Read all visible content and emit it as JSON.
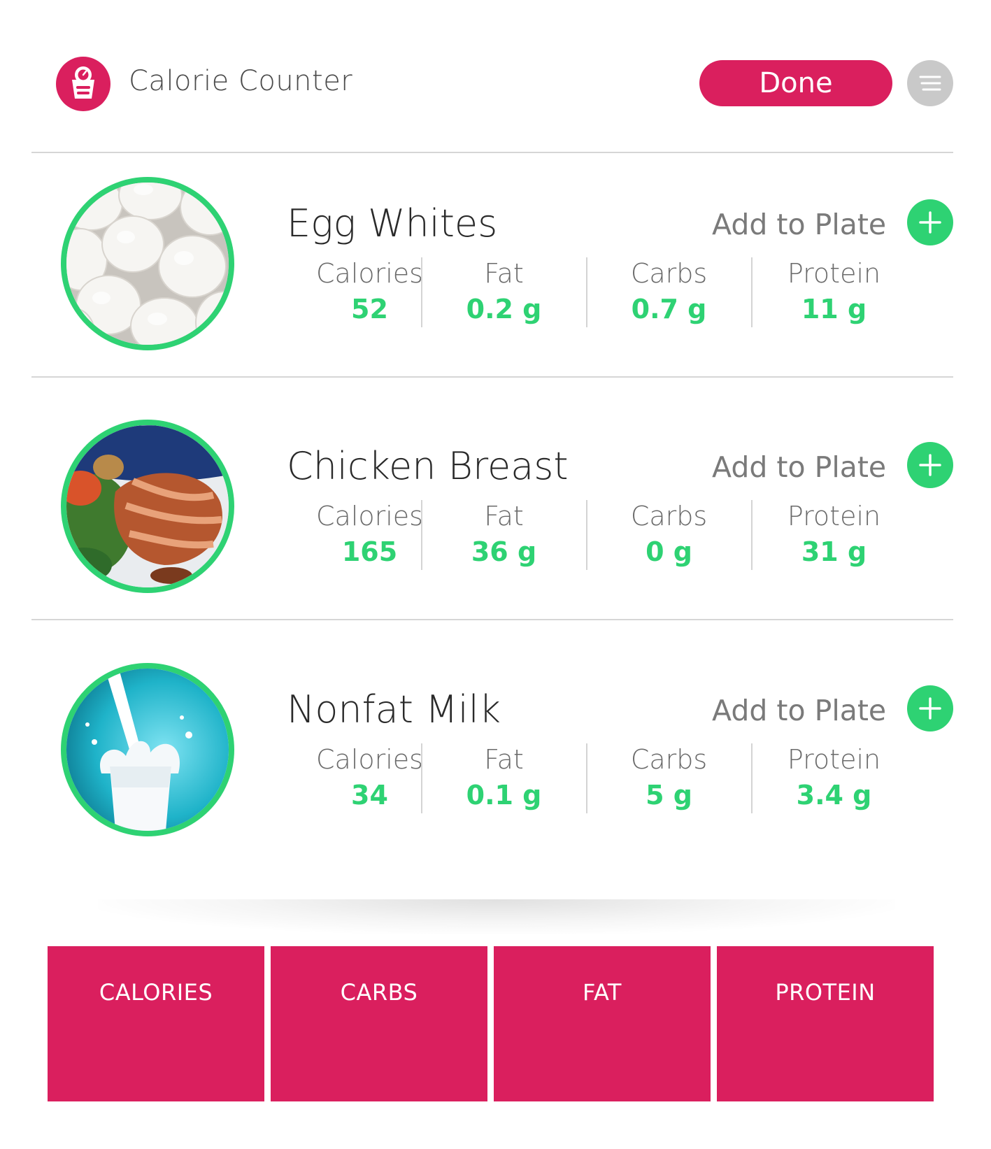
{
  "header": {
    "app_title": "Calorie Counter",
    "done_label": "Done",
    "logo_icon": "scale-icon",
    "menu_icon": "menu-icon"
  },
  "colors": {
    "accent": "#da1f5e",
    "positive": "#2ed273",
    "menu_button": "#c9c9c9"
  },
  "foods": [
    {
      "name": "Egg Whites",
      "add_label": "Add to Plate",
      "image": "egg-whites-photo",
      "stats": [
        {
          "label": "Calories",
          "value": "52"
        },
        {
          "label": "Fat",
          "value": "0.2 g"
        },
        {
          "label": "Carbs",
          "value": "0.7 g"
        },
        {
          "label": "Protein",
          "value": "11 g"
        }
      ]
    },
    {
      "name": "Chicken Breast",
      "add_label": "Add to Plate",
      "image": "chicken-breast-photo",
      "stats": [
        {
          "label": "Calories",
          "value": "165"
        },
        {
          "label": "Fat",
          "value": "36 g"
        },
        {
          "label": "Carbs",
          "value": "0 g"
        },
        {
          "label": "Protein",
          "value": "31 g"
        }
      ]
    },
    {
      "name": "Nonfat Milk",
      "add_label": "Add to Plate",
      "image": "nonfat-milk-photo",
      "stats": [
        {
          "label": "Calories",
          "value": "34"
        },
        {
          "label": "Fat",
          "value": "0.1 g"
        },
        {
          "label": "Carbs",
          "value": "5 g"
        },
        {
          "label": "Protein",
          "value": "3.4 g"
        }
      ]
    }
  ],
  "summary_tiles": [
    {
      "label": "CALORIES"
    },
    {
      "label": "CARBS"
    },
    {
      "label": "FAT"
    },
    {
      "label": "PROTEIN"
    }
  ]
}
